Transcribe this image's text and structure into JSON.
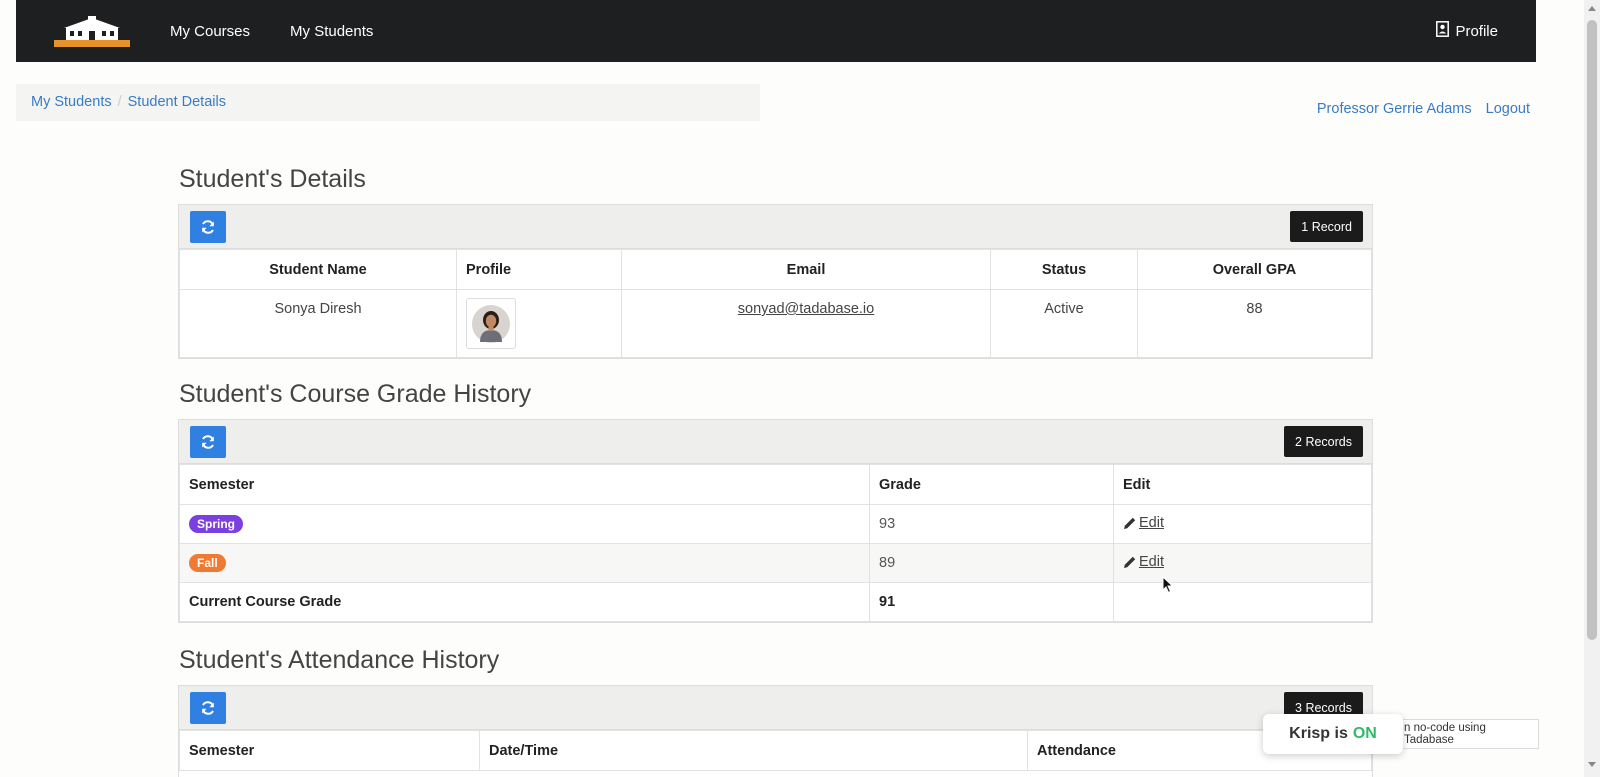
{
  "nav": {
    "items": [
      "My Courses",
      "My Students"
    ],
    "profile_label": "Profile"
  },
  "breadcrumb": [
    "My Students",
    "Student Details"
  ],
  "user": {
    "name": "Professor Gerrie Adams",
    "logout": "Logout"
  },
  "details": {
    "title": "Student's Details",
    "record_count": "1 Record",
    "columns": [
      "Student Name",
      "Profile",
      "Email",
      "Status",
      "Overall GPA"
    ],
    "row": {
      "name": "Sonya Diresh",
      "email": "sonyad@tadabase.io",
      "status": "Active",
      "gpa": "88"
    }
  },
  "grades": {
    "title": "Student's Course Grade History",
    "record_count": "2 Records",
    "columns": [
      "Semester",
      "Grade",
      "Edit"
    ],
    "rows": [
      {
        "semester": "Spring",
        "color": "#7c3fe0",
        "grade": "93",
        "edit": " Edit"
      },
      {
        "semester": "Fall",
        "color": "#f07a32",
        "grade": "89",
        "edit": " Edit"
      }
    ],
    "total": {
      "label": "Current Course Grade",
      "grade": "91"
    }
  },
  "attendance": {
    "title": "Student's Attendance History",
    "record_count": "3 Records",
    "columns": [
      "Semester",
      "Date/Time",
      "Attendance"
    ]
  },
  "footer": {
    "tadabase": "n no-code using Tadabase"
  },
  "krisp": {
    "label": "Krisp is",
    "state": "ON"
  }
}
